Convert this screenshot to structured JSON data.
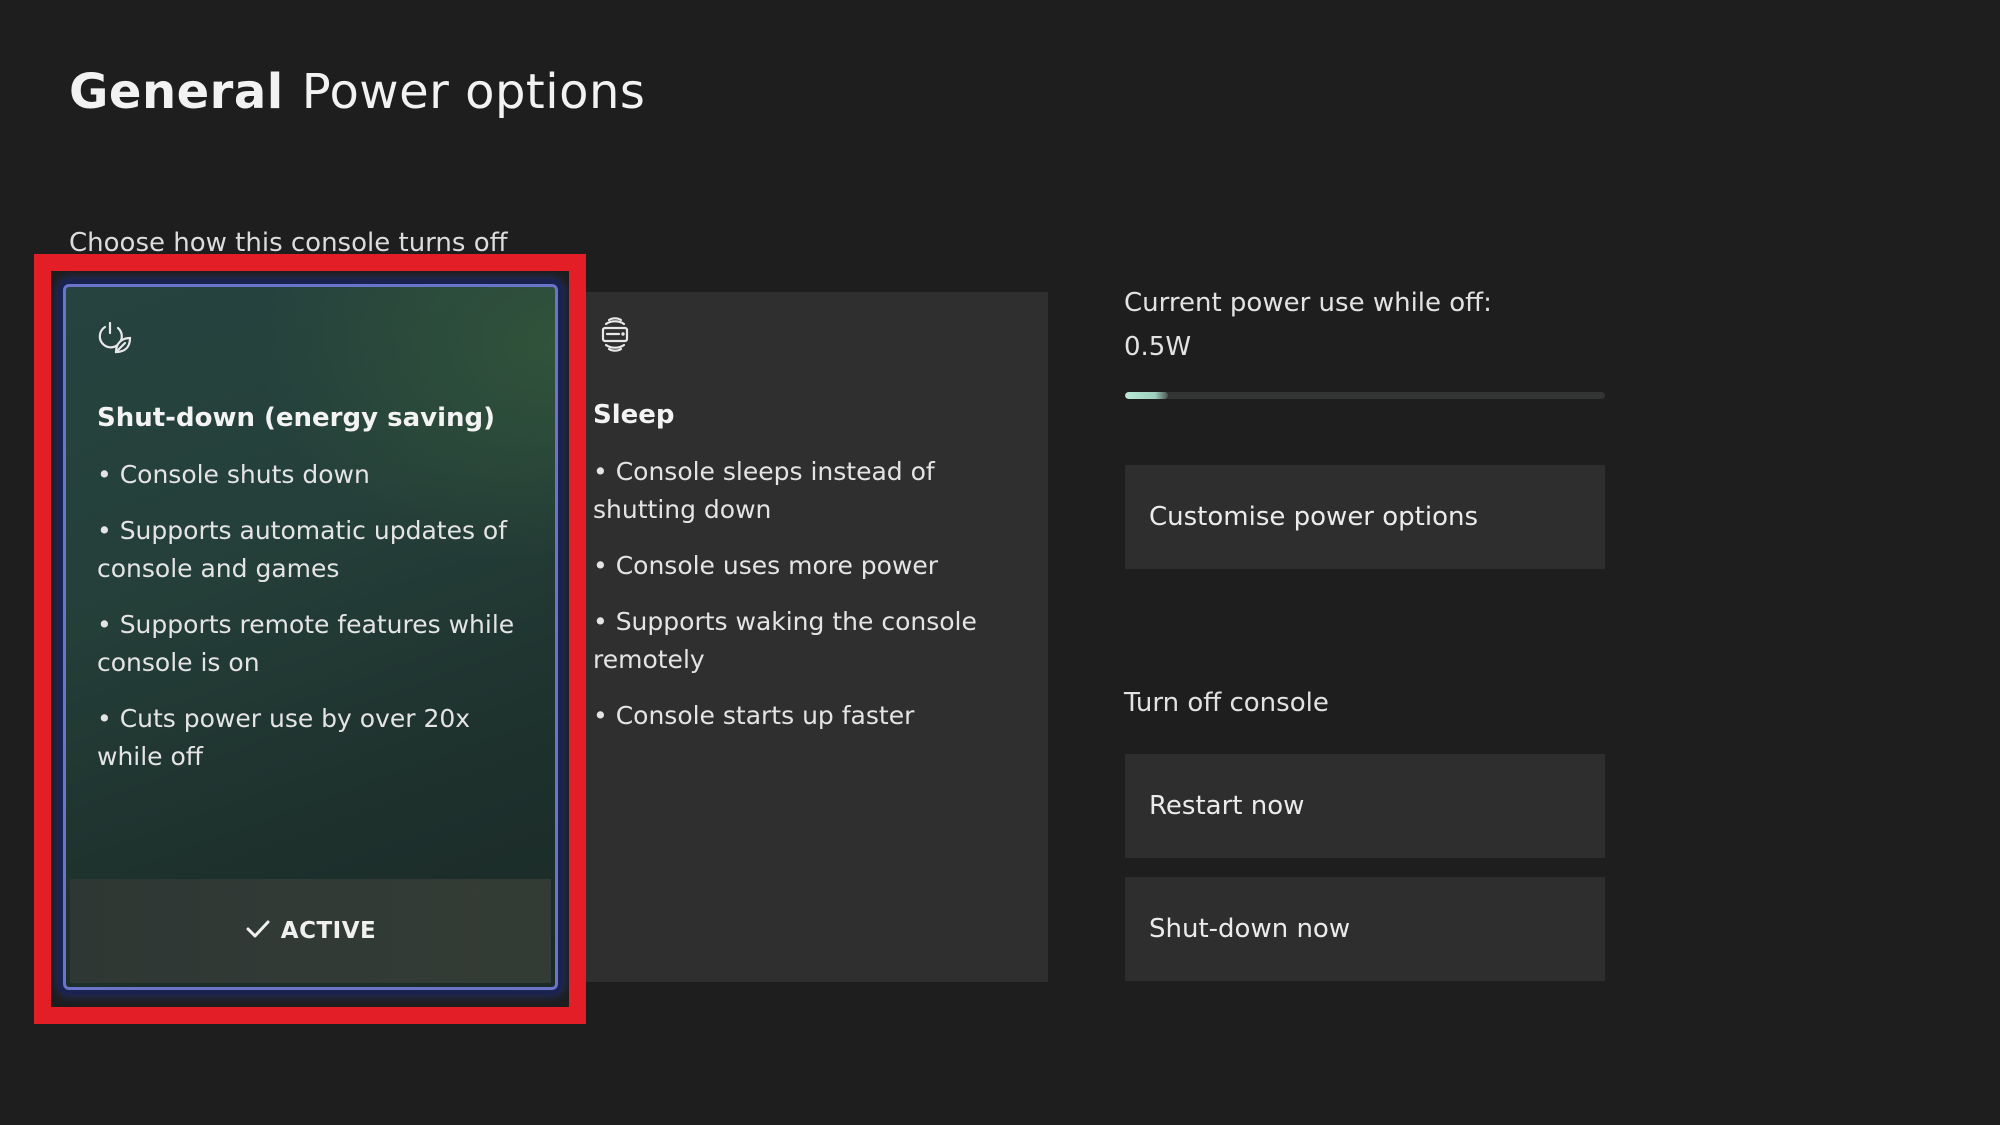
{
  "header": {
    "breadcrumb": "General",
    "title": "Power options"
  },
  "power_mode": {
    "section_label": "Choose how this console turns off",
    "options": [
      {
        "id": "shutdown",
        "icon": "power-leaf-icon",
        "title": "Shut-down (energy saving)",
        "bullets": [
          "• Console shuts down",
          "• Supports automatic updates of console and games",
          "• Supports remote features while console is on",
          "• Cuts power use by over 20x while off"
        ],
        "status": "ACTIVE",
        "status_icon": "checkmark-icon",
        "selected": true
      },
      {
        "id": "sleep",
        "icon": "console-sleep-icon",
        "title": "Sleep",
        "bullets": [
          "• Console sleeps instead of shutting down",
          "• Console uses more power",
          "• Supports waking the console remotely",
          "• Console starts up faster"
        ],
        "selected": false
      }
    ]
  },
  "power_usage": {
    "label": "Current power use while off:",
    "value": "0.5W",
    "meter_fraction": 0.09
  },
  "buttons": {
    "customise": "Customise power options",
    "restart": "Restart now",
    "shutdown": "Shut-down now"
  },
  "turn_off": {
    "label": "Turn off console"
  },
  "colors": {
    "background": "#1e1e1e",
    "card": "#2f2f2f",
    "active_border": "#6a74c8",
    "highlight_annotation": "#e41e26",
    "meter_fill": "#b9e8d6"
  }
}
